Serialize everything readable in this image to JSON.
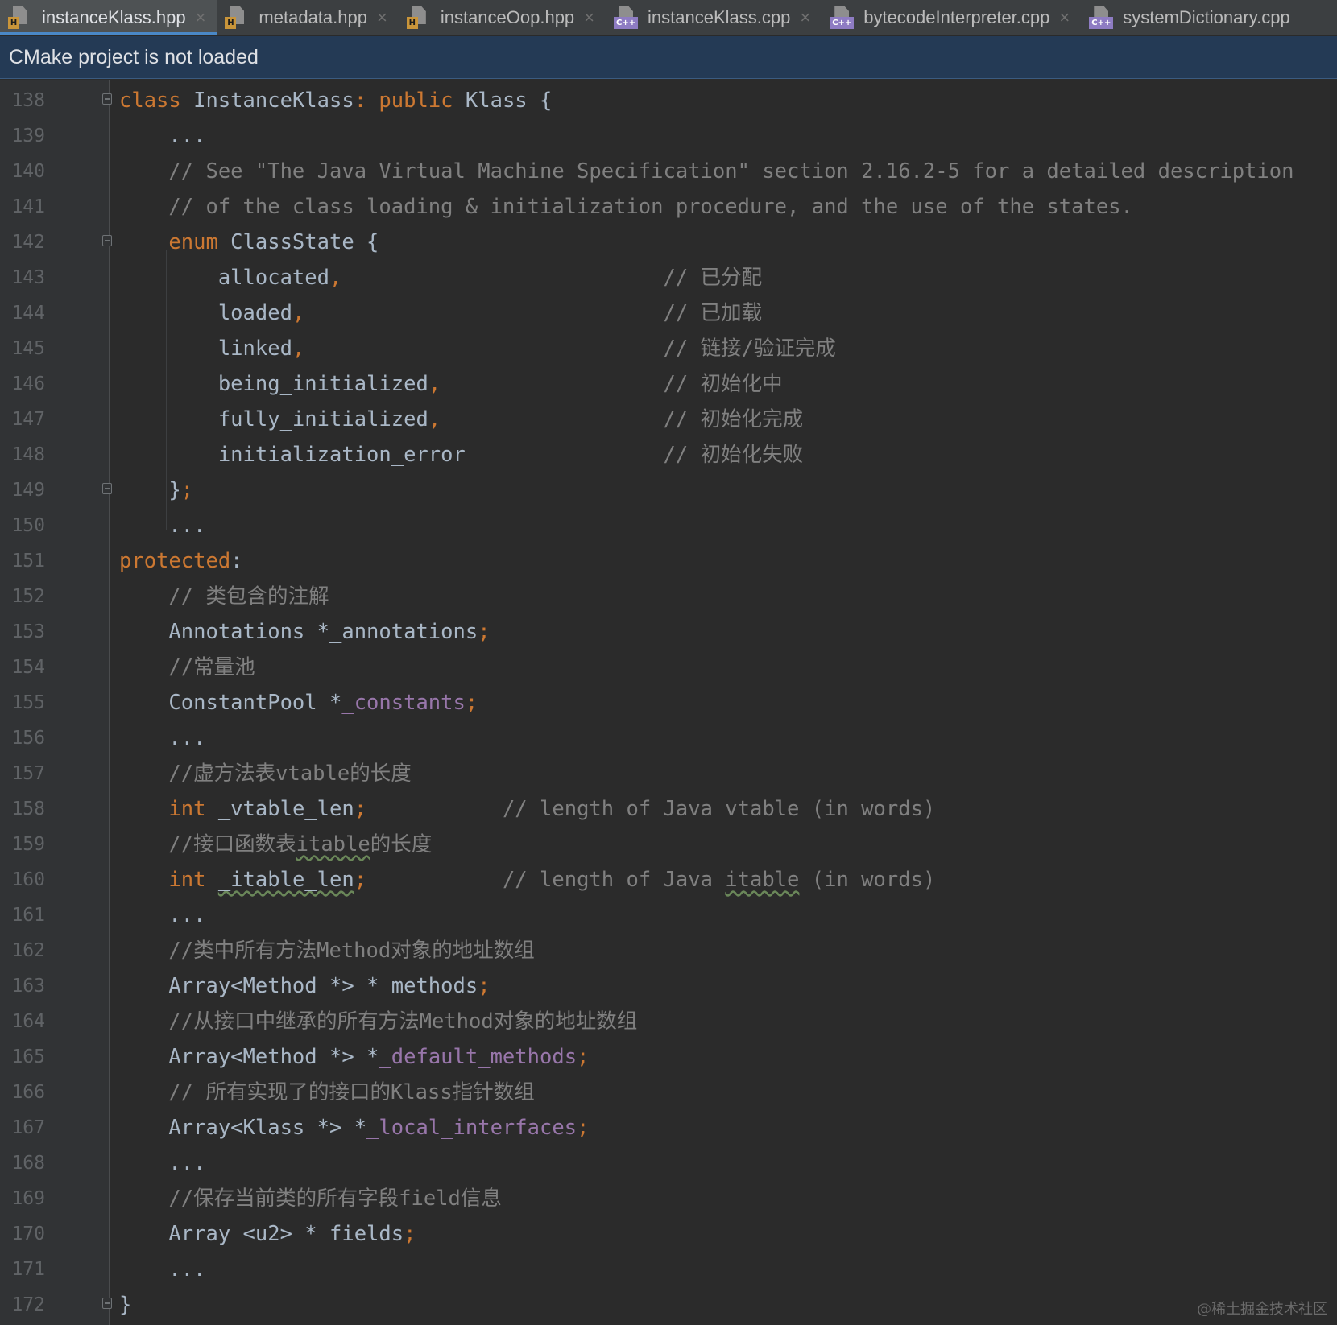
{
  "tabs": [
    {
      "label": "instanceKlass.hpp",
      "type": "H",
      "active": true
    },
    {
      "label": "metadata.hpp",
      "type": "H",
      "active": false
    },
    {
      "label": "instanceOop.hpp",
      "type": "H",
      "active": false
    },
    {
      "label": "instanceKlass.cpp",
      "type": "C++",
      "active": false
    },
    {
      "label": "bytecodeInterpreter.cpp",
      "type": "C++",
      "active": false
    },
    {
      "label": "systemDictionary.cpp",
      "type": "C++",
      "active": false
    }
  ],
  "tab_close_glyph": "×",
  "notice": "CMake project is not loaded",
  "editor": {
    "lines": [
      {
        "n": "138",
        "fold": true,
        "tokens": [
          [
            "kw",
            "class "
          ],
          [
            "p",
            "InstanceKlass"
          ],
          [
            "kw",
            ": public "
          ],
          [
            "p",
            "Klass {"
          ]
        ]
      },
      {
        "n": "139",
        "tokens": [
          [
            "p",
            "    ..."
          ]
        ]
      },
      {
        "n": "140",
        "tokens": [
          [
            "c",
            "    // See \"The Java Virtual Machine Specification\" section 2.16.2-5 for a detailed description"
          ]
        ]
      },
      {
        "n": "141",
        "tokens": [
          [
            "c",
            "    // of the class loading & initialization procedure, and the use of the states."
          ]
        ]
      },
      {
        "n": "142",
        "fold": true,
        "tokens": [
          [
            "kw",
            "    enum "
          ],
          [
            "p",
            "ClassState {"
          ]
        ]
      },
      {
        "n": "143",
        "tokens": [
          [
            "p",
            "        allocated"
          ],
          [
            "kw",
            ","
          ],
          [
            "c",
            "                          // 已分配"
          ]
        ]
      },
      {
        "n": "144",
        "tokens": [
          [
            "p",
            "        loaded"
          ],
          [
            "kw",
            ","
          ],
          [
            "c",
            "                             // 已加载"
          ]
        ]
      },
      {
        "n": "145",
        "tokens": [
          [
            "p",
            "        linked"
          ],
          [
            "kw",
            ","
          ],
          [
            "c",
            "                             // 链接/验证完成"
          ]
        ]
      },
      {
        "n": "146",
        "tokens": [
          [
            "p",
            "        being_initialized"
          ],
          [
            "kw",
            ","
          ],
          [
            "c",
            "                  // 初始化中"
          ]
        ]
      },
      {
        "n": "147",
        "tokens": [
          [
            "p",
            "        fully_initialized"
          ],
          [
            "kw",
            ","
          ],
          [
            "c",
            "                  // 初始化完成"
          ]
        ]
      },
      {
        "n": "148",
        "tokens": [
          [
            "p",
            "        initialization_error"
          ],
          [
            "c",
            "                // 初始化失败"
          ]
        ]
      },
      {
        "n": "149",
        "fold": true,
        "tokens": [
          [
            "p",
            "    }"
          ],
          [
            "kw",
            ";"
          ]
        ]
      },
      {
        "n": "150",
        "tokens": [
          [
            "p",
            "    ..."
          ]
        ]
      },
      {
        "n": "151",
        "tokens": [
          [
            "kw",
            "protected"
          ],
          [
            "p",
            ":"
          ]
        ]
      },
      {
        "n": "152",
        "tokens": [
          [
            "c",
            "    // 类包含的注解"
          ]
        ]
      },
      {
        "n": "153",
        "tokens": [
          [
            "p",
            "    Annotations *_annotations"
          ],
          [
            "kw",
            ";"
          ]
        ]
      },
      {
        "n": "154",
        "tokens": [
          [
            "c",
            "    //常量池"
          ]
        ]
      },
      {
        "n": "155",
        "tokens": [
          [
            "p",
            "    ConstantPool *"
          ],
          [
            "f",
            "_constants"
          ],
          [
            "kw",
            ";"
          ]
        ]
      },
      {
        "n": "156",
        "tokens": [
          [
            "p",
            "    ..."
          ]
        ]
      },
      {
        "n": "157",
        "tokens": [
          [
            "c",
            "    //虚方法表vtable的长度"
          ]
        ]
      },
      {
        "n": "158",
        "tokens": [
          [
            "kw",
            "    int "
          ],
          [
            "p",
            "_vtable_len"
          ],
          [
            "kw",
            ";"
          ],
          [
            "c",
            "           // length of Java vtable (in words)"
          ]
        ]
      },
      {
        "n": "159",
        "tokens": [
          [
            "c",
            "    //接口函数表"
          ],
          [
            "cs",
            "itable"
          ],
          [
            "c",
            "的长度"
          ]
        ]
      },
      {
        "n": "160",
        "tokens": [
          [
            "kw",
            "    int "
          ],
          [
            "ps",
            "_itable_len"
          ],
          [
            "kw",
            ";"
          ],
          [
            "c",
            "           // length of Java "
          ],
          [
            "cs",
            "itable"
          ],
          [
            "c",
            " (in words)"
          ]
        ]
      },
      {
        "n": "161",
        "tokens": [
          [
            "p",
            "    ..."
          ]
        ]
      },
      {
        "n": "162",
        "tokens": [
          [
            "c",
            "    //类中所有方法Method对象的地址数组"
          ]
        ]
      },
      {
        "n": "163",
        "tokens": [
          [
            "p",
            "    Array<Method *> *_methods"
          ],
          [
            "kw",
            ";"
          ]
        ]
      },
      {
        "n": "164",
        "tokens": [
          [
            "c",
            "    //从接口中继承的所有方法Method对象的地址数组"
          ]
        ]
      },
      {
        "n": "165",
        "tokens": [
          [
            "p",
            "    Array<Method *> *"
          ],
          [
            "f",
            "_default_methods"
          ],
          [
            "kw",
            ";"
          ]
        ]
      },
      {
        "n": "166",
        "tokens": [
          [
            "c",
            "    // 所有实现了的接口的Klass指针数组"
          ]
        ]
      },
      {
        "n": "167",
        "tokens": [
          [
            "p",
            "    Array<Klass *> *"
          ],
          [
            "f",
            "_local_interfaces"
          ],
          [
            "kw",
            ";"
          ]
        ]
      },
      {
        "n": "168",
        "tokens": [
          [
            "p",
            "    ..."
          ]
        ]
      },
      {
        "n": "169",
        "tokens": [
          [
            "c",
            "    //保存当前类的所有字段field信息"
          ]
        ]
      },
      {
        "n": "170",
        "tokens": [
          [
            "p",
            "    Array <u2> *_fields"
          ],
          [
            "kw",
            ";"
          ]
        ]
      },
      {
        "n": "171",
        "tokens": [
          [
            "p",
            "    ..."
          ]
        ]
      },
      {
        "n": "172",
        "fold": true,
        "tokens": [
          [
            "p",
            "}"
          ]
        ]
      }
    ]
  },
  "watermark": "@稀土掘金技术社区",
  "colors": {
    "background": "#2b2b2b",
    "gutter": "#313335",
    "keyword": "#cc7832",
    "comment": "#808080",
    "plain": "#a9b7c6",
    "field": "#9876aa",
    "notice_bg": "#243a55",
    "tab_accent": "#4a88c7"
  }
}
